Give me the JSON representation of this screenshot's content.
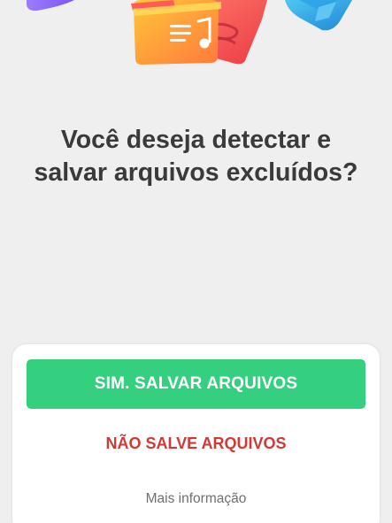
{
  "illustration": {
    "icons": [
      "purple-card-icon",
      "folder-icon",
      "music-document-icon",
      "cube-icon"
    ]
  },
  "dialog": {
    "question": "Você deseja detectar e\nsalvar arquivos excluídos?",
    "primary_button": "SIM. SALVAR ARQUIVOS",
    "secondary_button": "NÃO SALVE ARQUIVOS",
    "more_info_link": "Mais informação"
  },
  "colors": {
    "background": "#efefef",
    "primary_button": "#34cf7f",
    "secondary_text": "#cf3a36",
    "question_text": "#3a3a3a",
    "link_text": "#6f6f6f"
  }
}
